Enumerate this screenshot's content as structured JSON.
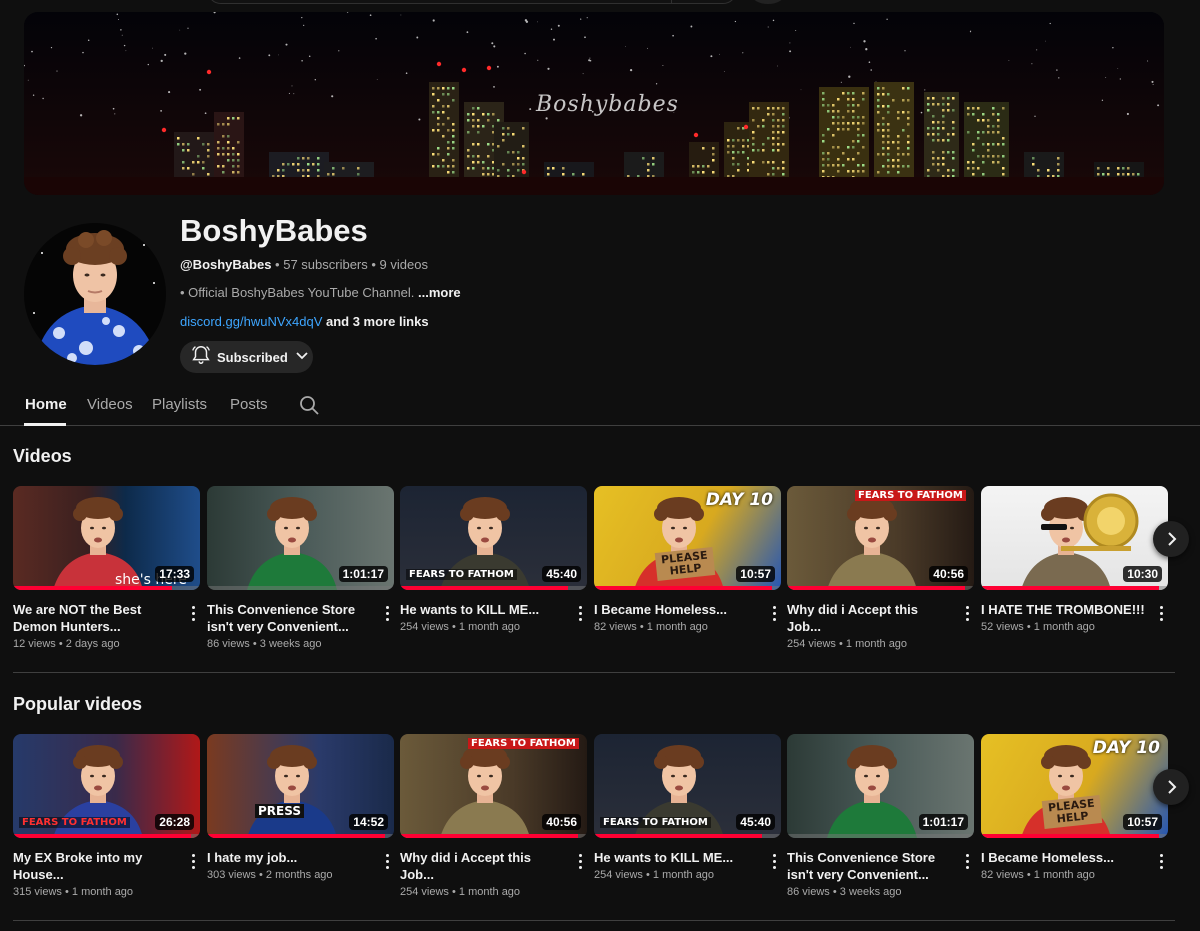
{
  "channel": {
    "banner_title": "Boshybabes",
    "name": "BoshyBabes",
    "handle": "@BoshyBabes",
    "subscribers": "57 subscribers",
    "video_count": "9 videos",
    "separator": " • ",
    "description": "• Official BoshyBabes YouTube Channel.",
    "more_label": "...more",
    "link": "discord.gg/hwuNVx4dqV",
    "more_links": "and 3 more links",
    "subscribe_label": "Subscribed"
  },
  "tabs": [
    {
      "label": "Home",
      "active": true
    },
    {
      "label": "Videos",
      "active": false
    },
    {
      "label": "Playlists",
      "active": false
    },
    {
      "label": "Posts",
      "active": false
    }
  ],
  "sections": [
    {
      "title": "Videos",
      "videos": [
        {
          "title": "We are NOT the Best Demon Hunters...",
          "views": "12 views",
          "age": "2 days ago",
          "duration": "17:33",
          "progress": 0.85,
          "theme": "demon",
          "caption": "she's here"
        },
        {
          "title": "This Convenience Store isn't very Convenient...",
          "views": "86 views",
          "age": "3 weeks ago",
          "duration": "1:01:17",
          "progress": 0.0,
          "theme": "store",
          "caption": ""
        },
        {
          "title": "He wants to KILL ME...",
          "views": "254 views",
          "age": "1 month ago",
          "duration": "45:40",
          "progress": 0.9,
          "theme": "night",
          "caption": "FEARS TO FATHOM"
        },
        {
          "title": "I Became Homeless...",
          "views": "82 views",
          "age": "1 month ago",
          "duration": "10:57",
          "progress": 0.95,
          "theme": "homeless",
          "caption": "DAY 10",
          "sign": "PLEASE HELP"
        },
        {
          "title": "Why did i Accept this Job...",
          "views": "254 views",
          "age": "1 month ago",
          "duration": "40:56",
          "progress": 0.95,
          "theme": "ranger",
          "caption": "FEARS TO FATHOM"
        },
        {
          "title": "I HATE THE TROMBONE!!!",
          "views": "52 views",
          "age": "1 month ago",
          "duration": "10:30",
          "progress": 0.95,
          "theme": "trombone",
          "caption": ""
        }
      ]
    },
    {
      "title": "Popular videos",
      "videos": [
        {
          "title": "My EX Broke into my House...",
          "views": "315 views",
          "age": "1 month ago",
          "duration": "26:28",
          "progress": 0.95,
          "theme": "bed",
          "caption": "FEARS TO FATHOM"
        },
        {
          "title": "I hate my job...",
          "views": "303 views",
          "age": "2 months ago",
          "duration": "14:52",
          "progress": 0.95,
          "theme": "press",
          "caption": "PRESS"
        },
        {
          "title": "Why did i Accept this Job...",
          "views": "254 views",
          "age": "1 month ago",
          "duration": "40:56",
          "progress": 0.95,
          "theme": "ranger",
          "caption": "FEARS TO FATHOM"
        },
        {
          "title": "He wants to KILL ME...",
          "views": "254 views",
          "age": "1 month ago",
          "duration": "45:40",
          "progress": 0.9,
          "theme": "night",
          "caption": "FEARS TO FATHOM"
        },
        {
          "title": "This Convenience Store isn't very Convenient...",
          "views": "86 views",
          "age": "3 weeks ago",
          "duration": "1:01:17",
          "progress": 0.0,
          "theme": "store",
          "caption": ""
        },
        {
          "title": "I Became Homeless...",
          "views": "82 views",
          "age": "1 month ago",
          "duration": "10:57",
          "progress": 0.95,
          "theme": "homeless",
          "caption": "DAY 10",
          "sign": "PLEASE HELP"
        }
      ]
    }
  ],
  "icons": {
    "bell": "bell-icon",
    "chevron": "chevron-down-icon",
    "search": "search-icon",
    "next": "chevron-right-icon",
    "kebab": "more-vert-icon"
  },
  "colors": {
    "background": "#0f0f0f",
    "link": "#3ea6ff",
    "progress": "#ff0033",
    "secondary_text": "#aaaaaa"
  }
}
